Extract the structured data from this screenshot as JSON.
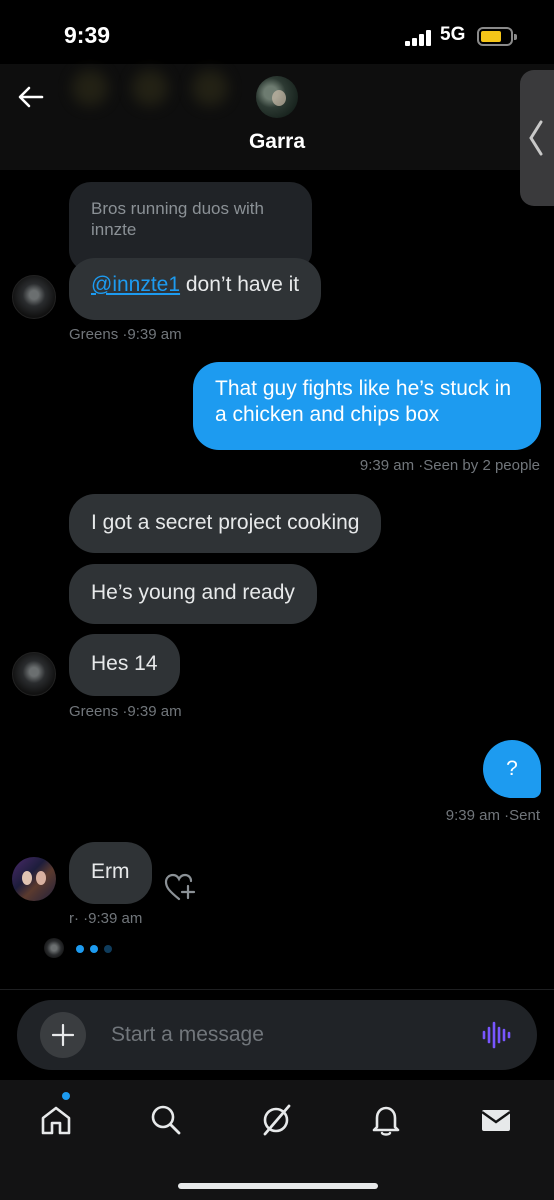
{
  "status_bar": {
    "time": "9:39",
    "network": "5G"
  },
  "header": {
    "name": "Garra"
  },
  "messages": {
    "quoted_text": "Bros running duos with innzte",
    "m1_mention": "@innzte1",
    "m1_text": " don’t have it",
    "meta1_sender": "Greens",
    "meta1_time": "9:39 am",
    "m2_text": "That guy fights like he’s stuck in a chicken and chips box",
    "meta2_time": "9:39 am",
    "meta2_status": "Seen by 2 people",
    "m3_text": "I got a secret project cooking",
    "m4_text": "He’s young and ready",
    "m5_text": "Hes 14",
    "meta3_sender": "Greens",
    "meta3_time": "9:39 am",
    "m6_text": "?",
    "meta4_time": "9:39 am",
    "meta4_status": "Sent",
    "m7_text": "Erm",
    "meta5_sender": "r·",
    "meta5_time": "9:39 am"
  },
  "composer": {
    "placeholder": "Start a message",
    "value": ""
  },
  "colors": {
    "accent": "#1d9bf0",
    "incoming_bubble": "#2f3336",
    "voice_icon": "#7856ff",
    "battery": "#f5c518"
  },
  "tab_bar": {
    "tabs": [
      {
        "icon": "home-icon",
        "notification": true
      },
      {
        "icon": "search-icon"
      },
      {
        "icon": "grok-icon"
      },
      {
        "icon": "bell-icon"
      },
      {
        "icon": "mail-icon"
      }
    ]
  }
}
